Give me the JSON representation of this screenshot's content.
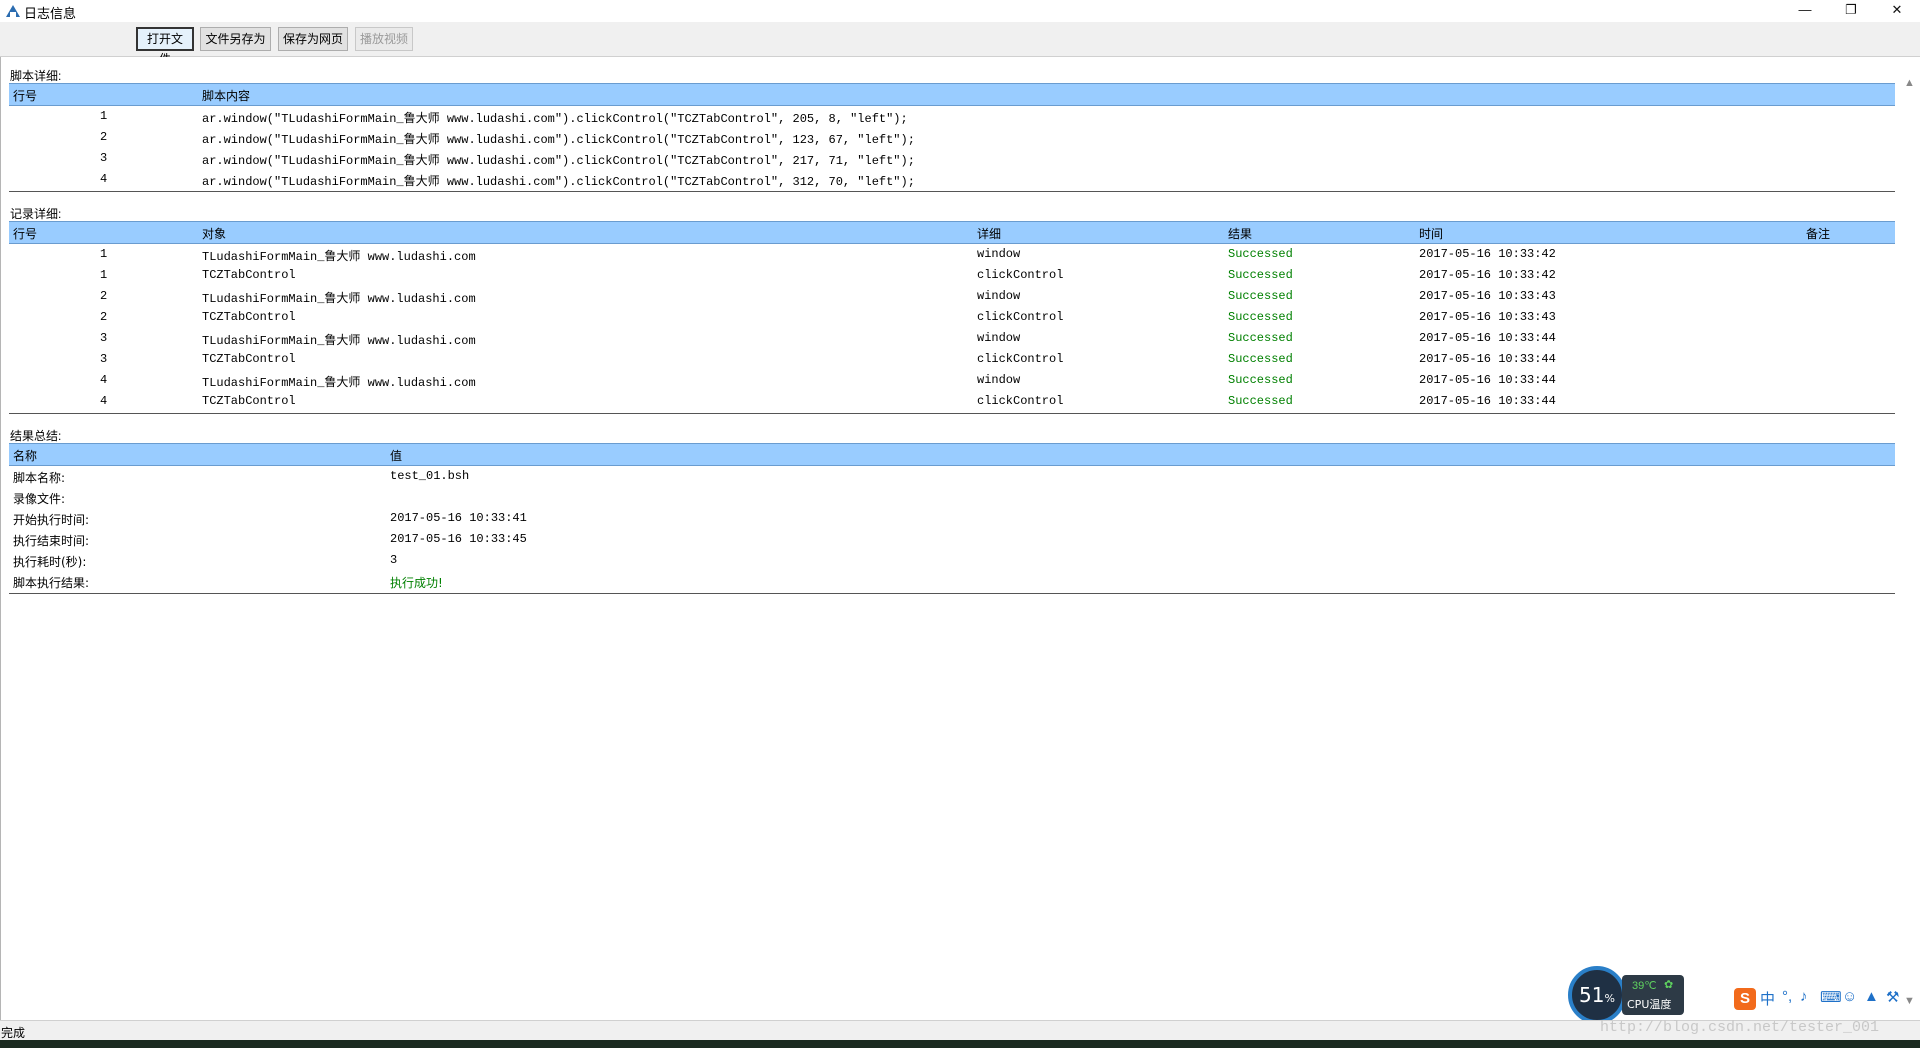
{
  "window": {
    "title": "日志信息"
  },
  "toolbar": {
    "open_file": "打开文件",
    "save_as": "文件另存为",
    "save_webpage": "保存为网页",
    "play_video": "播放视频"
  },
  "script_section": {
    "label": "脚本详细:",
    "headers": {
      "line": "行号",
      "content": "脚本内容"
    },
    "rows": [
      {
        "line": "1",
        "content": "ar.window(\"TLudashiFormMain_鲁大师 www.ludashi.com\").clickControl(\"TCZTabControl\", 205, 8, \"left\");"
      },
      {
        "line": "2",
        "content": "ar.window(\"TLudashiFormMain_鲁大师 www.ludashi.com\").clickControl(\"TCZTabControl\", 123, 67, \"left\");"
      },
      {
        "line": "3",
        "content": "ar.window(\"TLudashiFormMain_鲁大师 www.ludashi.com\").clickControl(\"TCZTabControl\", 217, 71, \"left\");"
      },
      {
        "line": "4",
        "content": "ar.window(\"TLudashiFormMain_鲁大师 www.ludashi.com\").clickControl(\"TCZTabControl\", 312, 70, \"left\");"
      }
    ]
  },
  "record_section": {
    "label": "记录详细:",
    "headers": {
      "line": "行号",
      "object": "对象",
      "detail": "详细",
      "result": "结果",
      "time": "时间",
      "note": "备注"
    },
    "rows": [
      {
        "line": "1",
        "object": "TLudashiFormMain_鲁大师 www.ludashi.com",
        "detail": "window",
        "result": "Successed",
        "time": "2017-05-16 10:33:42"
      },
      {
        "line": "1",
        "object": "TCZTabControl",
        "detail": "clickControl",
        "result": "Successed",
        "time": "2017-05-16 10:33:42"
      },
      {
        "line": "2",
        "object": "TLudashiFormMain_鲁大师 www.ludashi.com",
        "detail": "window",
        "result": "Successed",
        "time": "2017-05-16 10:33:43"
      },
      {
        "line": "2",
        "object": "TCZTabControl",
        "detail": "clickControl",
        "result": "Successed",
        "time": "2017-05-16 10:33:43"
      },
      {
        "line": "3",
        "object": "TLudashiFormMain_鲁大师 www.ludashi.com",
        "detail": "window",
        "result": "Successed",
        "time": "2017-05-16 10:33:44"
      },
      {
        "line": "3",
        "object": "TCZTabControl",
        "detail": "clickControl",
        "result": "Successed",
        "time": "2017-05-16 10:33:44"
      },
      {
        "line": "4",
        "object": "TLudashiFormMain_鲁大师 www.ludashi.com",
        "detail": "window",
        "result": "Successed",
        "time": "2017-05-16 10:33:44"
      },
      {
        "line": "4",
        "object": "TCZTabControl",
        "detail": "clickControl",
        "result": "Successed",
        "time": "2017-05-16 10:33:44"
      }
    ]
  },
  "summary_section": {
    "label": "结果总结:",
    "headers": {
      "name": "名称",
      "value": "值"
    },
    "rows": [
      {
        "name": "脚本名称:",
        "value": "test_01.bsh"
      },
      {
        "name": "录像文件:",
        "value": ""
      },
      {
        "name": "开始执行时间:",
        "value": "2017-05-16 10:33:41"
      },
      {
        "name": "执行结束时间:",
        "value": "2017-05-16 10:33:45"
      },
      {
        "name": "执行耗时(秒):",
        "value": "3"
      },
      {
        "name": "脚本执行结果:",
        "value": "执行成功!"
      }
    ]
  },
  "status": {
    "text": "完成"
  },
  "watermark": "http://blog.csdn.net/tester_001",
  "cpu_widget": {
    "usage": "51",
    "unit": "%",
    "temperature": "39℃",
    "label": "CPU温度"
  },
  "ime": {
    "logo": "S",
    "mode": "中"
  },
  "colors": {
    "header_bg": "#99ccff",
    "success": "#008000"
  }
}
